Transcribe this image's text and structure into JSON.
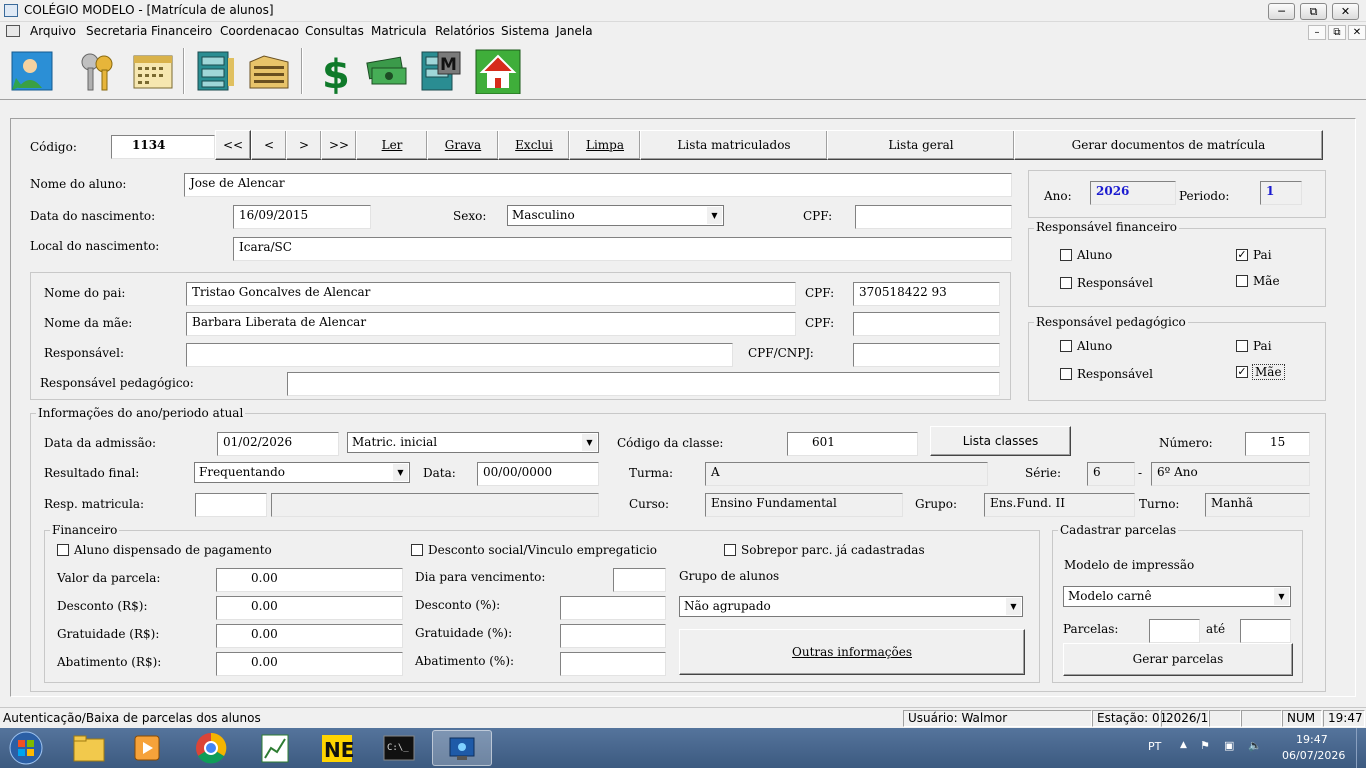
{
  "window": {
    "title": "COLÉGIO MODELO - [Matrícula de alunos]"
  },
  "menu": [
    "Arquivo",
    "Secretaria",
    "Financeiro",
    "Coordenacao",
    "Consultas",
    "Matricula",
    "Relatórios",
    "Sistema",
    "Janela"
  ],
  "nav": {
    "codigo_label": "Código:",
    "codigo": "1134",
    "first": "<<",
    "prev": "<",
    "next": ">",
    "last": ">>",
    "ler": "Ler",
    "grava": "Grava",
    "exclui": "Exclui",
    "limpa": "Limpa",
    "lista_matriculados": "Lista matriculados",
    "lista_geral": "Lista geral",
    "gerar_docs": "Gerar documentos de matrícula"
  },
  "aluno": {
    "nome_label": "Nome do aluno:",
    "nome": "Jose de Alencar",
    "nasc_label": "Data do nascimento:",
    "nasc": "16/09/2015",
    "sexo_label": "Sexo:",
    "sexo": "Masculino",
    "cpf_label": "CPF:",
    "cpf": "",
    "local_label": "Local do nascimento:",
    "local": "Icara/SC"
  },
  "periodo": {
    "ano_label": "Ano:",
    "ano": "2026",
    "periodo_label": "Periodo:",
    "periodo": "1"
  },
  "resp_fin": {
    "title": "Responsável financeiro",
    "aluno": "Aluno",
    "pai": "Pai",
    "responsavel": "Responsável",
    "mae": "Mãe",
    "checked": "pai"
  },
  "resp_ped": {
    "title": "Responsável pedagógico",
    "aluno": "Aluno",
    "pai": "Pai",
    "responsavel": "Responsável",
    "mae": "Mãe",
    "checked": "mae"
  },
  "pais": {
    "pai_label": "Nome do pai:",
    "pai": "Tristao Goncalves de Alencar",
    "pai_cpf_label": "CPF:",
    "pai_cpf": "370518422 93",
    "mae_label": "Nome da mãe:",
    "mae": "Barbara Liberata de Alencar",
    "mae_cpf_label": "CPF:",
    "mae_cpf": "",
    "resp_label": "Responsável:",
    "resp": "",
    "resp_cpf_label": "CPF/CNPJ:",
    "resp_cpf": "",
    "resp_ped_label": "Responsável pedagógico:",
    "resp_ped": ""
  },
  "info": {
    "title": "Informações do ano/periodo atual",
    "admissao_label": "Data da admissão:",
    "admissao": "01/02/2026",
    "tipo": "Matric. inicial",
    "classe_label": "Código da classe:",
    "classe": "601",
    "lista_classes": "Lista classes",
    "numero_label": "Número:",
    "numero": "15",
    "resultado_label": "Resultado final:",
    "resultado": "Frequentando",
    "data_label": "Data:",
    "data": "00/00/0000",
    "turma_label": "Turma:",
    "turma": "A",
    "serie_label": "Série:",
    "serie": "6",
    "serie_sep": "-",
    "serie_nome": "6º Ano",
    "resp_mat_label": "Resp. matricula:",
    "resp_mat": "",
    "curso_label": "Curso:",
    "curso": "Ensino Fundamental",
    "grupo_label": "Grupo:",
    "grupo": "Ens.Fund. II",
    "turno_label": "Turno:",
    "turno": "Manhã"
  },
  "financeiro": {
    "title": "Financeiro",
    "dispensado": "Aluno dispensado de pagamento",
    "desconto_social": "Desconto social/Vinculo empregaticio",
    "sobrepor": "Sobrepor parc. já cadastradas",
    "valor_label": "Valor da parcela:",
    "valor": "0.00",
    "desconto_label": "Desconto (R$):",
    "desconto": "0.00",
    "gratuidade_label": "Gratuidade (R$):",
    "gratuidade": "0.00",
    "abatimento_label": "Abatimento (R$):",
    "abatimento": "0.00",
    "dia_label": "Dia para vencimento:",
    "dia": "",
    "desc_pct_label": "Desconto (%):",
    "desc_pct": "",
    "grat_pct_label": "Gratuidade (%):",
    "grat_pct": "",
    "abat_pct_label": "Abatimento (%):",
    "abat_pct": "",
    "grupo_alunos_label": "Grupo de alunos",
    "grupo_alunos": "Não agrupado",
    "outras": "Outras informações"
  },
  "parcelas": {
    "title": "Cadastrar parcelas",
    "modelo_label": "Modelo de impressão",
    "modelo": "Modelo carnê",
    "parcelas_label": "Parcelas:",
    "ate_label": "até",
    "de": "",
    "ate": "",
    "gerar": "Gerar parcelas"
  },
  "status": {
    "msg": "Autenticação/Baixa de parcelas dos alunos",
    "usuario": "Usuário: Walmor",
    "estacao": "Estação: 01",
    "periodo": "2026/1",
    "num": "NUM",
    "hora": "19:47"
  },
  "taskbar": {
    "lang": "PT",
    "time": "19:47",
    "date": "06/07/2026"
  }
}
